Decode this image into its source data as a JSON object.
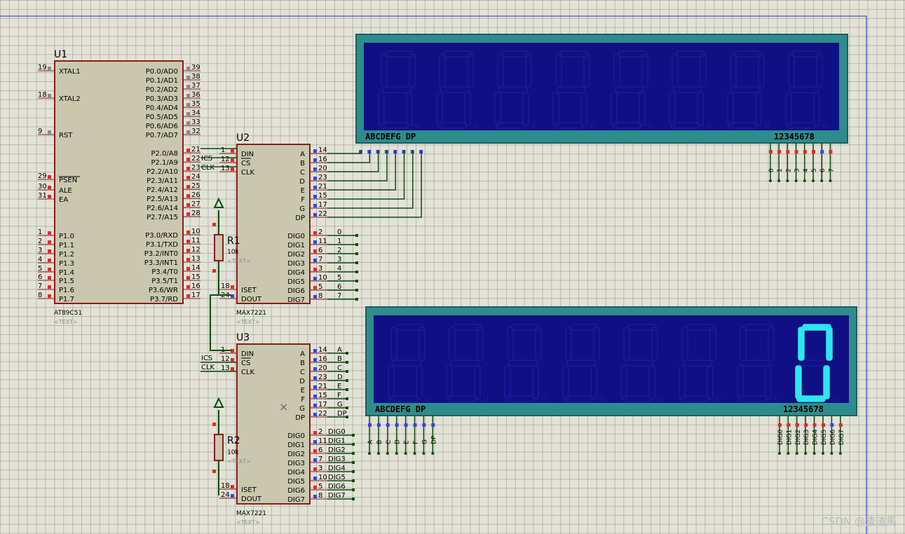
{
  "colors": {
    "chip_fill": "#c9c8ae",
    "chip_border": "#8b1c1c",
    "wire": "#0b4d0b",
    "display_frame": "#2f8c8c",
    "display_panel": "#101084",
    "segment_off": "#1a1a9a",
    "segment_on": "#2ee6ef",
    "pin_red": "#e62828",
    "pin_blue": "#3344ee",
    "pin_grey": "#8a8a8a"
  },
  "u1": {
    "ref": "U1",
    "part": "AT89C51",
    "text": "<TEXT>",
    "left_pins": [
      {
        "num": "19",
        "name": "XTAL1"
      },
      {
        "num": "18",
        "name": "XTAL2"
      },
      {
        "num": "9",
        "name": "RST"
      },
      {
        "num": "29",
        "name": "PSEN"
      },
      {
        "num": "30",
        "name": "ALE"
      },
      {
        "num": "31",
        "name": "EA"
      },
      {
        "num": "1",
        "name": "P1.0"
      },
      {
        "num": "2",
        "name": "P1.1"
      },
      {
        "num": "3",
        "name": "P1.2"
      },
      {
        "num": "4",
        "name": "P1.3"
      },
      {
        "num": "5",
        "name": "P1.4"
      },
      {
        "num": "6",
        "name": "P1.5"
      },
      {
        "num": "7",
        "name": "P1.6"
      },
      {
        "num": "8",
        "name": "P1.7"
      }
    ],
    "right_pins": [
      {
        "num": "39",
        "name": "P0.0/AD0"
      },
      {
        "num": "38",
        "name": "P0.1/AD1"
      },
      {
        "num": "37",
        "name": "P0.2/AD2"
      },
      {
        "num": "36",
        "name": "P0.3/AD3"
      },
      {
        "num": "35",
        "name": "P0.4/AD4"
      },
      {
        "num": "34",
        "name": "P0.5/AD5"
      },
      {
        "num": "33",
        "name": "P0.6/AD6"
      },
      {
        "num": "32",
        "name": "P0.7/AD7"
      },
      {
        "num": "21",
        "name": "P2.0/A8"
      },
      {
        "num": "22",
        "name": "P2.1/A9"
      },
      {
        "num": "23",
        "name": "P2.2/A10"
      },
      {
        "num": "24",
        "name": "P2.3/A11"
      },
      {
        "num": "25",
        "name": "P2.4/A12"
      },
      {
        "num": "26",
        "name": "P2.5/A13"
      },
      {
        "num": "27",
        "name": "P2.6/A14"
      },
      {
        "num": "28",
        "name": "P2.7/A15"
      },
      {
        "num": "10",
        "name": "P3.0/RXD"
      },
      {
        "num": "11",
        "name": "P3.1/TXD"
      },
      {
        "num": "12",
        "name": "P3.2/INT0"
      },
      {
        "num": "13",
        "name": "P3.3/INT1"
      },
      {
        "num": "14",
        "name": "P3.4/T0"
      },
      {
        "num": "15",
        "name": "P3.5/T1"
      },
      {
        "num": "16",
        "name": "P3.6/WR"
      },
      {
        "num": "17",
        "name": "P3.7/RD"
      }
    ],
    "net_labels": [
      "ICS",
      "CLK"
    ]
  },
  "u2": {
    "ref": "U2",
    "part": "MAX7221",
    "text": "<TEXT>",
    "left_pins": [
      {
        "num": "1",
        "name": "DIN"
      },
      {
        "num": "12",
        "name": "CS"
      },
      {
        "num": "13",
        "name": "CLK"
      },
      {
        "num": "18",
        "name": "ISET"
      },
      {
        "num": "24",
        "name": "DOUT"
      }
    ],
    "right_pins": [
      {
        "num": "14",
        "name": "A"
      },
      {
        "num": "16",
        "name": "B"
      },
      {
        "num": "20",
        "name": "C"
      },
      {
        "num": "23",
        "name": "D"
      },
      {
        "num": "21",
        "name": "E"
      },
      {
        "num": "15",
        "name": "F"
      },
      {
        "num": "17",
        "name": "G"
      },
      {
        "num": "22",
        "name": "DP"
      },
      {
        "num": "2",
        "name": "DIG0"
      },
      {
        "num": "11",
        "name": "DIG1"
      },
      {
        "num": "6",
        "name": "DIG2"
      },
      {
        "num": "7",
        "name": "DIG3"
      },
      {
        "num": "3",
        "name": "DIG4"
      },
      {
        "num": "10",
        "name": "DIG5"
      },
      {
        "num": "5",
        "name": "DIG6"
      },
      {
        "num": "8",
        "name": "DIG7"
      }
    ],
    "dig_net_labels": [
      "0",
      "1",
      "2",
      "3",
      "4",
      "5",
      "6",
      "7"
    ]
  },
  "u3": {
    "ref": "U3",
    "part": "MAX7221",
    "text": "<TEXT>",
    "left_pins": [
      {
        "num": "1",
        "name": "DIN"
      },
      {
        "num": "12",
        "name": "CS"
      },
      {
        "num": "13",
        "name": "CLK"
      },
      {
        "num": "18",
        "name": "ISET"
      },
      {
        "num": "24",
        "name": "DOUT"
      }
    ],
    "right_pins": [
      {
        "num": "14",
        "name": "A"
      },
      {
        "num": "16",
        "name": "B"
      },
      {
        "num": "20",
        "name": "C"
      },
      {
        "num": "23",
        "name": "D"
      },
      {
        "num": "21",
        "name": "E"
      },
      {
        "num": "15",
        "name": "F"
      },
      {
        "num": "17",
        "name": "G"
      },
      {
        "num": "22",
        "name": "DP"
      },
      {
        "num": "2",
        "name": "DIG0"
      },
      {
        "num": "11",
        "name": "DIG1"
      },
      {
        "num": "6",
        "name": "DIG2"
      },
      {
        "num": "7",
        "name": "DIG3"
      },
      {
        "num": "3",
        "name": "DIG4"
      },
      {
        "num": "10",
        "name": "DIG5"
      },
      {
        "num": "5",
        "name": "DIG6"
      },
      {
        "num": "8",
        "name": "DIG7"
      }
    ],
    "net_labels": [
      "ICS",
      "CLK"
    ],
    "seg_net_labels": [
      "A",
      "B",
      "C",
      "D",
      "E",
      "F",
      "G",
      "DP"
    ],
    "dig_net_labels": [
      "DIG0",
      "DIG1",
      "DIG2",
      "DIG3",
      "DIG4",
      "DIG5",
      "DIG6",
      "DIG7"
    ]
  },
  "r1": {
    "ref": "R1",
    "value": "10k",
    "text": "<TEXT>"
  },
  "r2": {
    "ref": "R2",
    "value": "10k",
    "text": "<TEXT>"
  },
  "display1": {
    "seg_label": "ABCDEFG  DP",
    "dig_label": "12345678",
    "lit": [
      null,
      null,
      null,
      null,
      null,
      null,
      null,
      null
    ],
    "bottom_labels": [
      "0",
      "1",
      "2",
      "3",
      "4",
      "5",
      "6",
      "7"
    ]
  },
  "display2": {
    "seg_label": "ABCDEFG  DP",
    "dig_label": "12345678",
    "lit": [
      null,
      null,
      null,
      null,
      null,
      null,
      null,
      "0"
    ],
    "seg_bottom_labels": [
      "A",
      "B",
      "C",
      "D",
      "E",
      "F",
      "G",
      "DP"
    ],
    "dig_bottom_labels": [
      "DIG0",
      "DIG1",
      "DIG2",
      "DIG3",
      "DIG4",
      "DIG5",
      "DIG6",
      "DIG7"
    ]
  },
  "watermark": "CSDN @渣渣馬"
}
